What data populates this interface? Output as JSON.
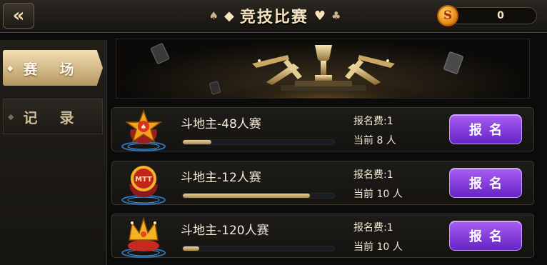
{
  "header": {
    "back_icon": "double-chevron-left-icon",
    "title": "竞技比赛",
    "coin_symbol": "S",
    "coin_balance": "0"
  },
  "sidebar": {
    "tabs": [
      {
        "label": "赛 场",
        "active": true
      },
      {
        "label": "记 录",
        "active": false
      }
    ]
  },
  "matches": [
    {
      "name": "斗地主-48人赛",
      "fee": "报名费:1",
      "current": "当前 8 人",
      "button": "报名",
      "progress": 0.19,
      "emblem": "star-badge-icon"
    },
    {
      "name": "斗地主-12人赛",
      "fee": "报名费:1",
      "current": "当前 10 人",
      "button": "报名",
      "progress": 0.84,
      "emblem": "mtt-badge-icon",
      "emblem_text": "MTT"
    },
    {
      "name": "斗地主-120人赛",
      "fee": "报名费:1",
      "current": "当前 10 人",
      "button": "报名",
      "progress": 0.11,
      "emblem": "crown-badge-icon"
    }
  ],
  "colors": {
    "accent_gold": "#e9d39b",
    "button_purple": "#7b34d6",
    "active_tab": "#d9c18e"
  }
}
